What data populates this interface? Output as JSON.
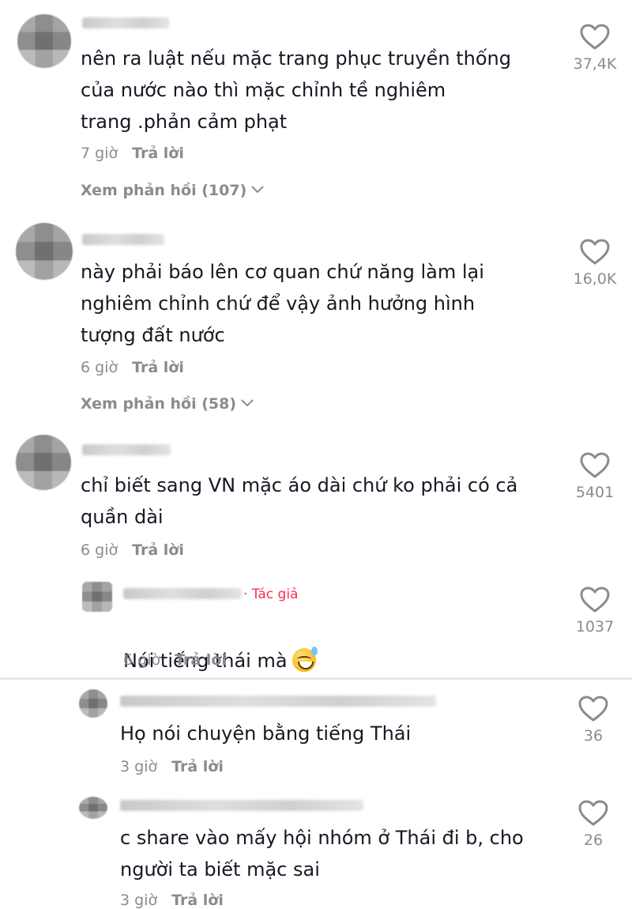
{
  "comments": [
    {
      "text": "nên ra luật nếu mặc trang phục truyền thống\ncủa nước nào thì mặc chỉnh tề nghiêm\ntrang .phản cảm phạt",
      "time": "7 giờ",
      "reply": "Trả lời",
      "likes": "37,4K",
      "view_replies": "Xem phản hồi (107)"
    },
    {
      "text": "này phải báo lên cơ quan chứ năng làm lại\nnghiêm chỉnh chứ để vậy ảnh hưởng hình\ntượng đất nước",
      "time": "6 giờ",
      "reply": "Trả lời",
      "likes": "16,0K",
      "view_replies": "Xem phản hồi (58)"
    },
    {
      "text": "chỉ biết sang VN mặc áo dài chứ ko phải có cả\nquần dài",
      "time": "6 giờ",
      "reply": "Trả lời",
      "likes": "5401"
    }
  ],
  "author_reply": {
    "tag": "· Tác giả",
    "text": "Nói tiếng thái mà",
    "time": "6 giờ",
    "reply": "Trả lời",
    "likes": "1037"
  },
  "sub_replies": [
    {
      "text": "Họ nói chuyện bằng tiếng Thái",
      "time": "3 giờ",
      "reply": "Trả lời",
      "likes": "36"
    },
    {
      "text": "c share vào mấy hội nhóm ở Thái đi b, cho\nngười ta biết mặc sai",
      "time": "3 giờ",
      "reply": "Trả lời",
      "likes": "26"
    }
  ],
  "colors": {
    "text": "#161823",
    "muted": "#8a8b91",
    "author_tag": "#fe2c55"
  }
}
